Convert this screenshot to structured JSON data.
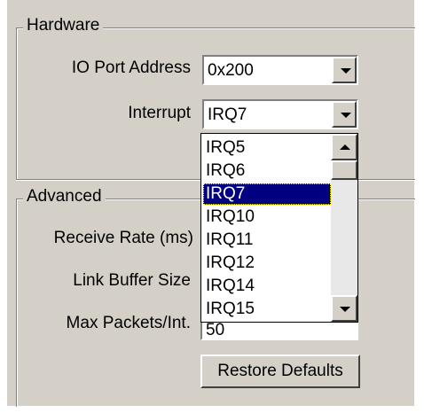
{
  "hardware": {
    "legend": "Hardware",
    "io_port_label": "IO Port Address",
    "io_port_value": "0x200",
    "interrupt_label": "Interrupt",
    "interrupt_value": "IRQ7"
  },
  "interrupt_dropdown": {
    "options": [
      "IRQ5",
      "IRQ6",
      "IRQ7",
      "IRQ10",
      "IRQ11",
      "IRQ12",
      "IRQ14",
      "IRQ15"
    ],
    "highlighted": "IRQ7"
  },
  "advanced": {
    "legend": "Advanced",
    "receive_rate_label": "Receive Rate (ms)",
    "link_buffer_label": "Link Buffer Size",
    "max_packets_label": "Max Packets/Int.",
    "max_packets_value": "50",
    "restore_defaults_label": "Restore Defaults"
  },
  "colors": {
    "dialog_face": "#d4d0c8",
    "selection": "#000080",
    "selection_text": "#ffffff"
  }
}
